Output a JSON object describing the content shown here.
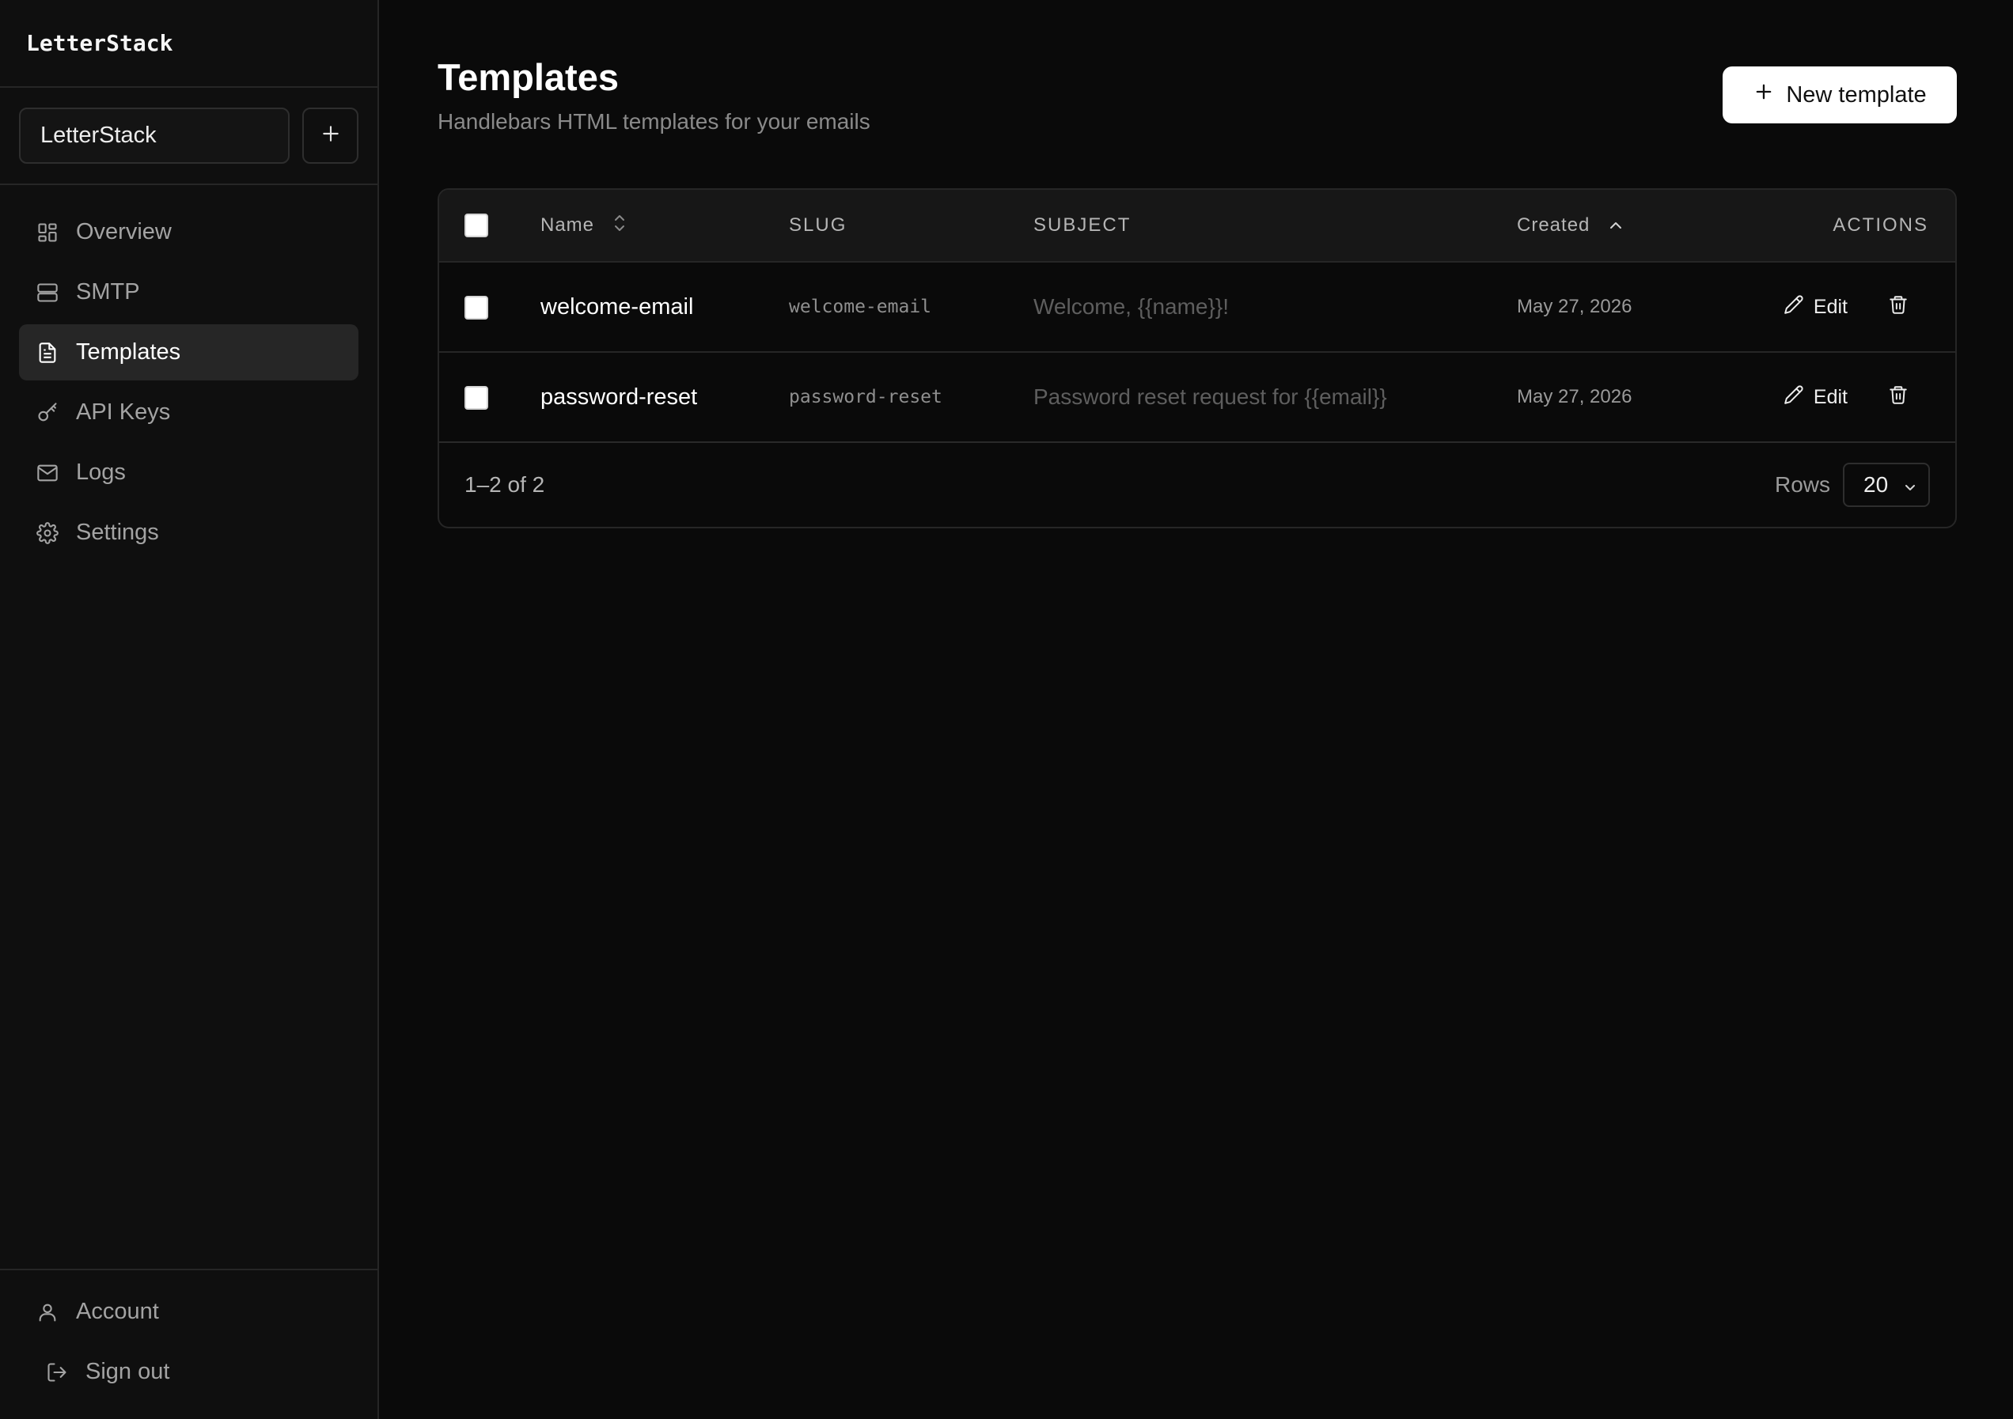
{
  "app": {
    "brand": "LetterStack"
  },
  "project": {
    "selected": "LetterStack"
  },
  "sidebar": {
    "items": [
      {
        "label": "Overview",
        "icon": "grid-icon"
      },
      {
        "label": "SMTP",
        "icon": "server-icon"
      },
      {
        "label": "Templates",
        "icon": "file-text-icon",
        "active": true
      },
      {
        "label": "API Keys",
        "icon": "key-icon"
      },
      {
        "label": "Logs",
        "icon": "mail-icon"
      },
      {
        "label": "Settings",
        "icon": "gear-icon"
      }
    ],
    "bottom": [
      {
        "label": "Account",
        "icon": "user-icon"
      },
      {
        "label": "Sign out",
        "icon": "logout-icon"
      }
    ]
  },
  "page": {
    "title": "Templates",
    "subtitle": "Handlebars HTML templates for your emails",
    "new_button": "New template"
  },
  "table": {
    "columns": {
      "name": "Name",
      "slug": "SLUG",
      "subject": "SUBJECT",
      "created": "Created",
      "actions": "ACTIONS"
    },
    "rows": [
      {
        "name": "welcome-email",
        "slug": "welcome-email",
        "subject": "Welcome, {{name}}!",
        "created": "May 27, 2026",
        "edit": "Edit"
      },
      {
        "name": "password-reset",
        "slug": "password-reset",
        "subject": "Password reset request for {{email}}",
        "created": "May 27, 2026",
        "edit": "Edit"
      }
    ],
    "footer": {
      "range": "1–2 of 2",
      "rows_label": "Rows",
      "rows_value": "20"
    }
  },
  "colors": {
    "background": "#0a0a0a",
    "sidebar": "#0f0f0f",
    "active_item": "#262626",
    "primary_button": "#ffffff"
  }
}
